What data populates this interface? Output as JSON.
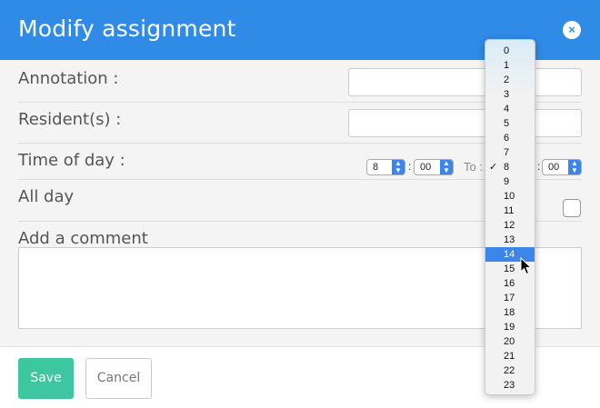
{
  "dialog": {
    "title": "Modify assignment",
    "close_glyph": "×"
  },
  "form": {
    "annotation_label": "Annotation :",
    "annotation_value": "",
    "residents_label": "Resident(s) :",
    "residents_value": "",
    "time_label": "Time of day :",
    "from_hour": "8",
    "from_minute": "00",
    "to_label": "To :",
    "to_minute": "00",
    "colon": ":",
    "allday_label": "All day",
    "comment_label": "Add a comment",
    "comment_value": ""
  },
  "footer": {
    "save_label": "Save",
    "cancel_label": "Cancel"
  },
  "hour_dropdown": {
    "options": [
      "0",
      "1",
      "2",
      "3",
      "4",
      "5",
      "6",
      "7",
      "8",
      "9",
      "10",
      "11",
      "12",
      "13",
      "14",
      "15",
      "16",
      "17",
      "18",
      "19",
      "20",
      "21",
      "22",
      "23"
    ],
    "checked": "8",
    "highlighted": "14",
    "check_glyph": "✓"
  },
  "colors": {
    "header": "#2f8be6",
    "save": "#3ec6a0",
    "highlight": "#3b86e8"
  }
}
